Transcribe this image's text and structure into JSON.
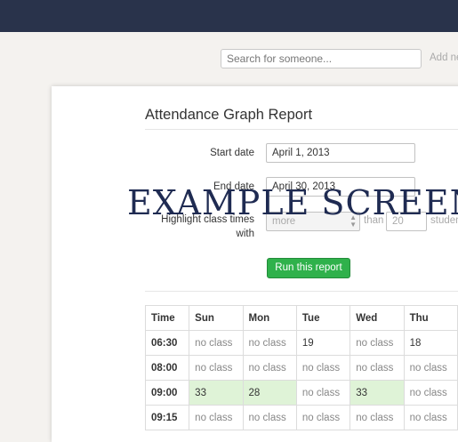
{
  "search": {
    "placeholder": "Search for someone...",
    "add_label": "Add ne"
  },
  "report": {
    "title": "Attendance Graph Report",
    "start_label": "Start date",
    "start_value": "April 1, 2013",
    "end_label": "End date",
    "end_value": "April 30, 2013",
    "highlight_label_1": "Highlight class times",
    "highlight_label_2": "with",
    "highlight_select": "more",
    "than_label": "than",
    "count_value": "20",
    "students_label": "studen",
    "run_button": "Run this report"
  },
  "table": {
    "headers": [
      "Time",
      "Sun",
      "Mon",
      "Tue",
      "Wed",
      "Thu"
    ],
    "rows": [
      {
        "time": "06:30",
        "cells": [
          "no class",
          "no class",
          "19",
          "no class",
          "18"
        ]
      },
      {
        "time": "08:00",
        "cells": [
          "no class",
          "no class",
          "no class",
          "no class",
          "no class"
        ]
      },
      {
        "time": "09:00",
        "cells": [
          "33",
          "28",
          "no class",
          "33",
          "no class"
        ]
      },
      {
        "time": "09:15",
        "cells": [
          "no class",
          "no class",
          "no class",
          "no class",
          "no class"
        ]
      }
    ]
  },
  "watermark": "EXAMPLE SCREEN",
  "colors": {
    "topbar": "#29334b",
    "accent_green": "#2fb14b",
    "highlight": "#dff3d7"
  }
}
